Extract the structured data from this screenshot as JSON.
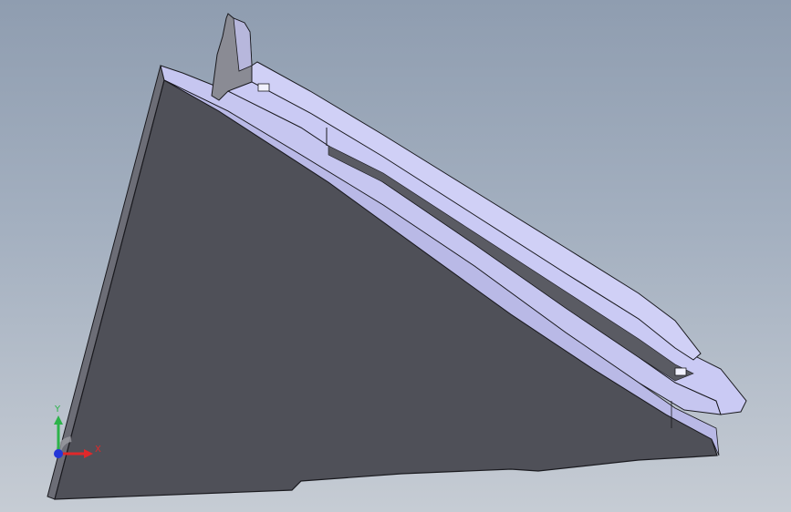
{
  "triad": {
    "y_label": "Y",
    "x_label": "X",
    "colors": {
      "x": "#e0282a",
      "y": "#2cb34a",
      "z": "#2436d8"
    }
  },
  "model": {
    "colors": {
      "main_face": "#4f5058",
      "bevel_face": "#c8c8f2",
      "edge": "#1a1a1f",
      "side_face": "#6a6b74"
    }
  }
}
